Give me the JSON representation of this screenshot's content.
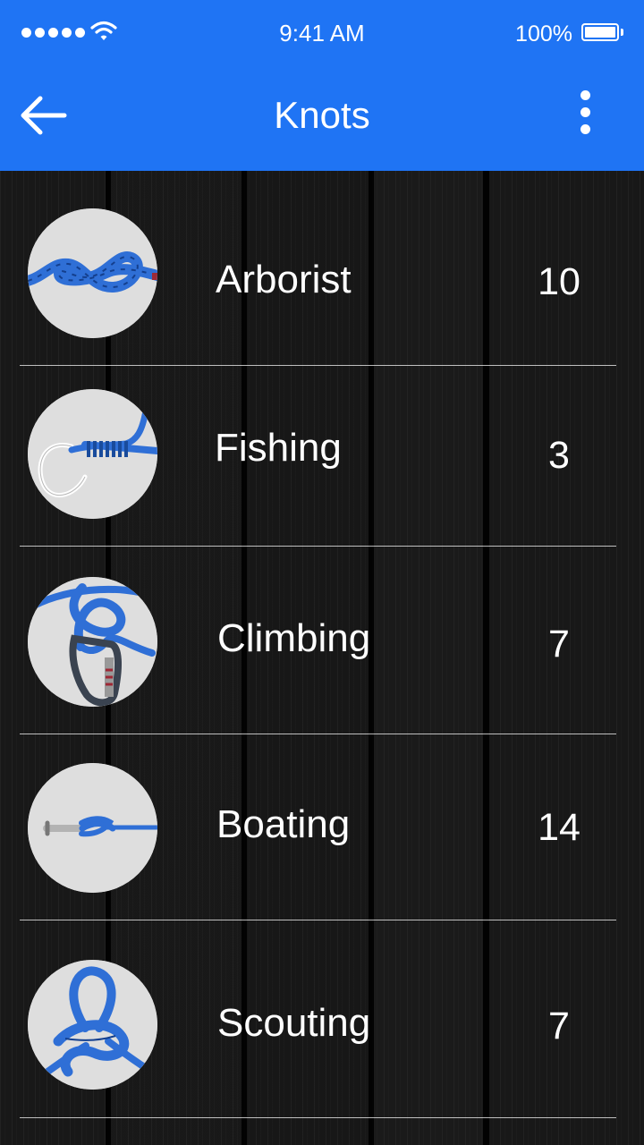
{
  "status_bar": {
    "time": "9:41 AM",
    "battery": "100%"
  },
  "nav": {
    "title": "Knots"
  },
  "knots": [
    {
      "label": "Arborist",
      "count": "10"
    },
    {
      "label": "Fishing",
      "count": "3"
    },
    {
      "label": "Climbing",
      "count": "7"
    },
    {
      "label": "Boating",
      "count": "14"
    },
    {
      "label": "Scouting",
      "count": "7"
    }
  ],
  "colors": {
    "header": "#1f74f4",
    "rope": "#2f6fd6"
  },
  "icons": {
    "back": "arrow-left",
    "menu": "more-vertical",
    "signal": "signal-dots",
    "wifi": "wifi",
    "battery": "battery-full"
  }
}
